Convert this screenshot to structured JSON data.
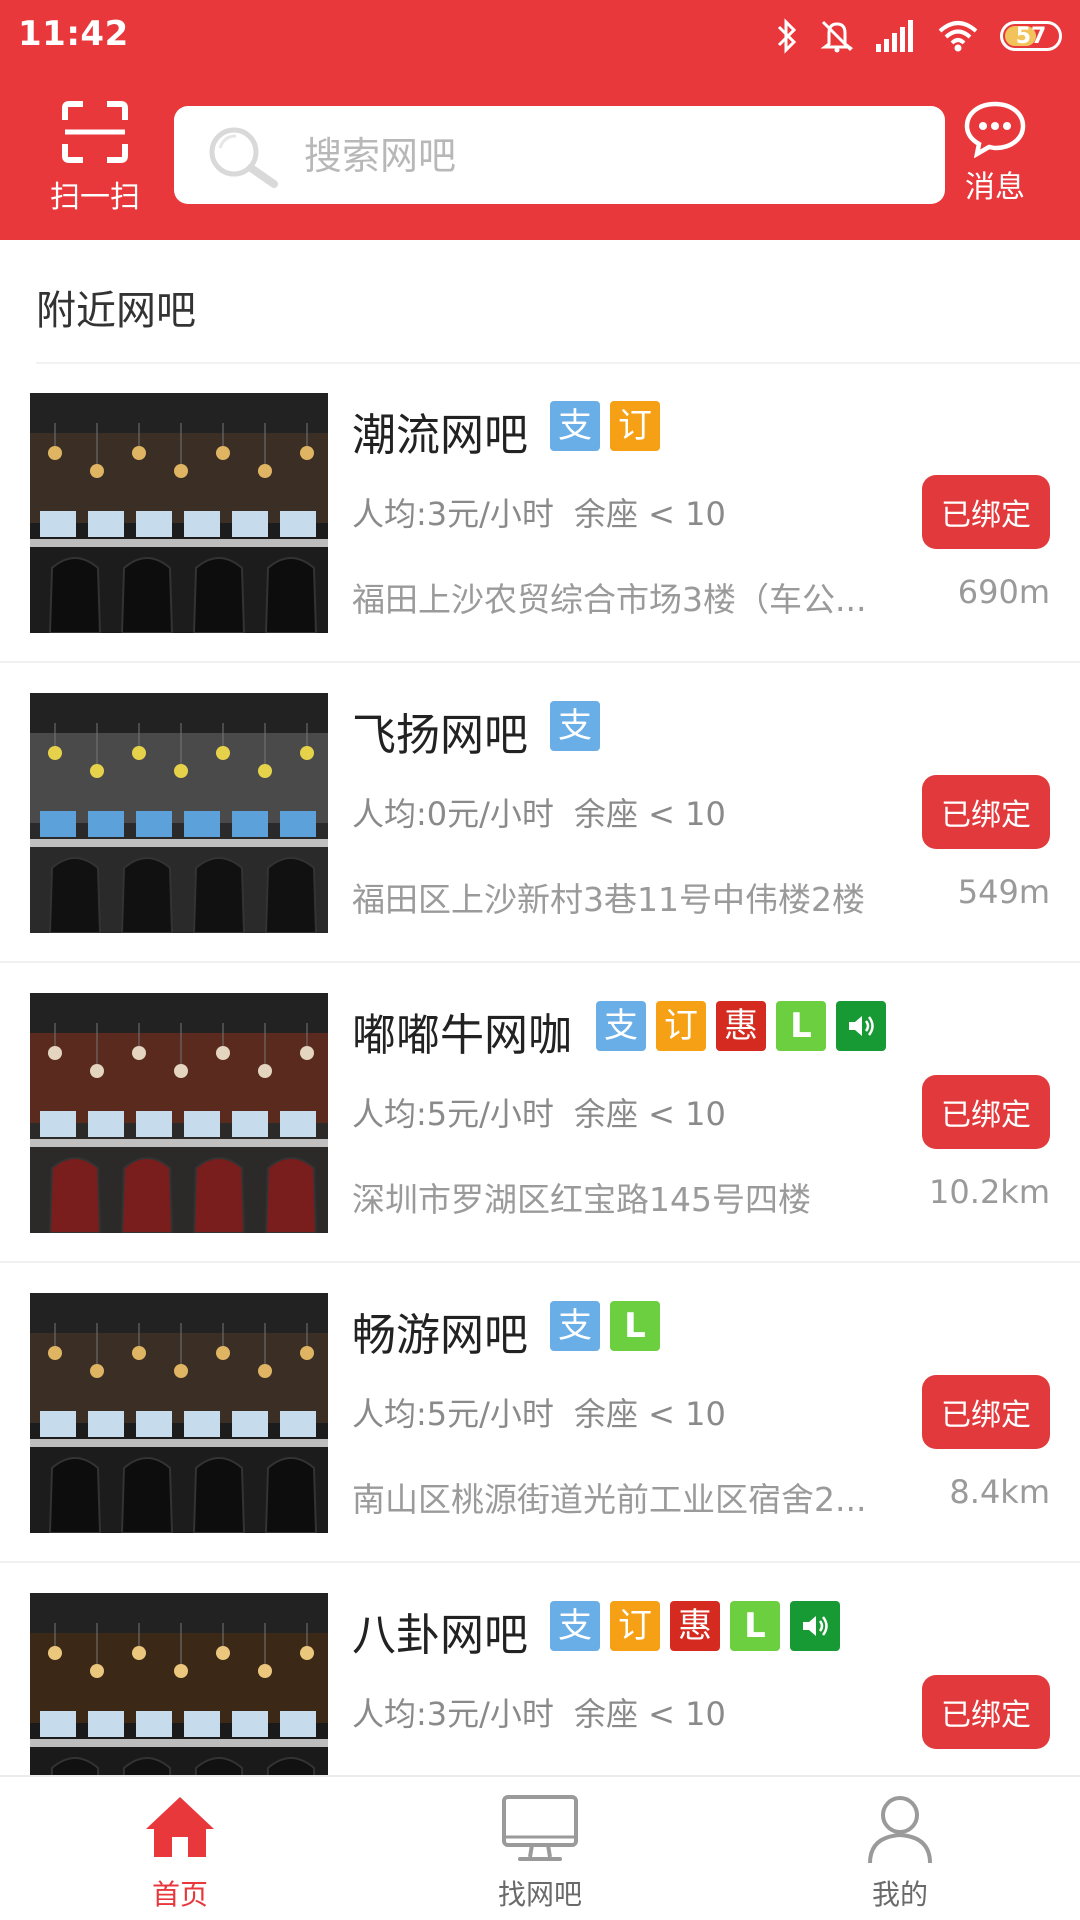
{
  "status_bar": {
    "time": "11:42",
    "battery": "57",
    "icons": [
      "bluetooth-icon",
      "mute-icon",
      "signal-icon",
      "wifi-icon",
      "battery-icon"
    ]
  },
  "header": {
    "scan_label": "扫一扫",
    "search_placeholder": "搜索网吧",
    "message_label": "消息",
    "accent_color": "#e8383c"
  },
  "section_title": "附近网吧",
  "tag_glyphs": {
    "pay": "支",
    "book": "订",
    "promo": "惠",
    "L": "L"
  },
  "bind_label": "已绑定",
  "cafes": [
    {
      "name": "潮流网吧",
      "tags": [
        "pay",
        "book"
      ],
      "price": "人均:3元/小时",
      "seats": "余座 < 10",
      "address": "福田上沙农贸综合市场3楼（车公...",
      "distance": "690m"
    },
    {
      "name": "飞扬网吧",
      "tags": [
        "pay"
      ],
      "price": "人均:0元/小时",
      "seats": "余座 < 10",
      "address": "福田区上沙新村3巷11号中伟楼2楼",
      "distance": "549m"
    },
    {
      "name": "嘟嘟牛网咖",
      "tags": [
        "pay",
        "book",
        "promo",
        "L",
        "sound"
      ],
      "price": "人均:5元/小时",
      "seats": "余座 < 10",
      "address": "深圳市罗湖区红宝路145号四楼",
      "distance": "10.2km"
    },
    {
      "name": "畅游网吧",
      "tags": [
        "pay",
        "L"
      ],
      "price": "人均:5元/小时",
      "seats": "余座 < 10",
      "address": "南山区桃源街道光前工业区宿舍2...",
      "distance": "8.4km"
    },
    {
      "name": "八卦网吧",
      "tags": [
        "pay",
        "book",
        "promo",
        "L",
        "sound"
      ],
      "price": "人均:3元/小时",
      "seats": "余座 < 10",
      "address": "",
      "distance": ""
    }
  ],
  "tabbar": {
    "items": [
      {
        "label": "首页",
        "icon": "home-icon",
        "active": true
      },
      {
        "label": "找网吧",
        "icon": "monitor-icon",
        "active": false
      },
      {
        "label": "我的",
        "icon": "user-icon",
        "active": false
      }
    ]
  }
}
